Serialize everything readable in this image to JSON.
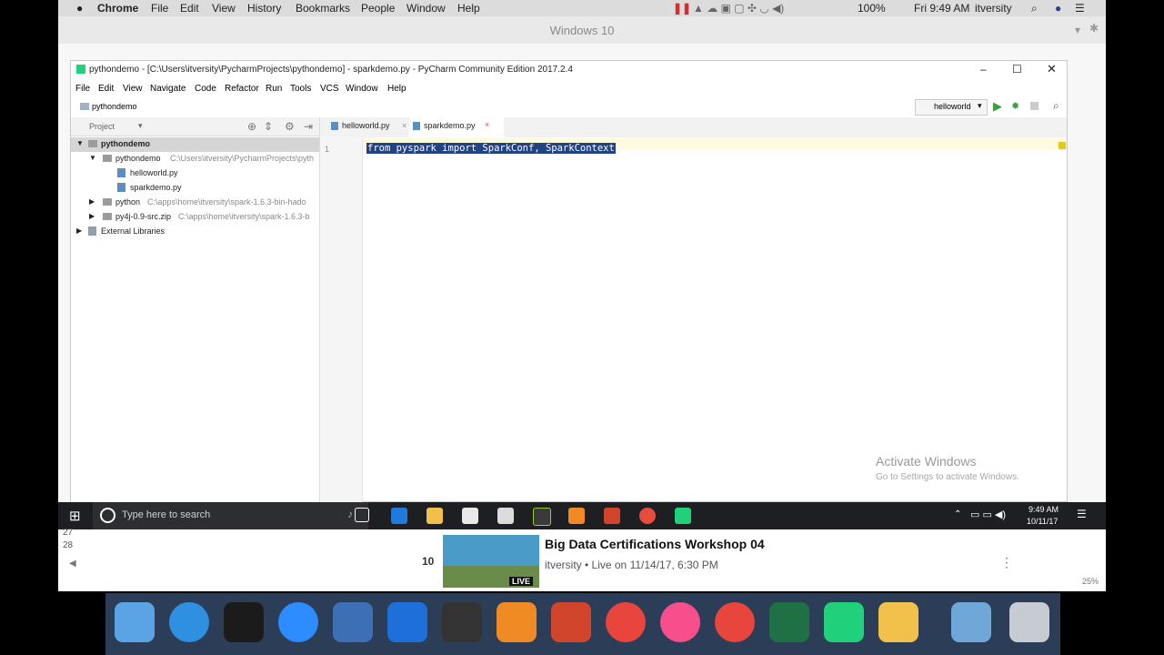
{
  "mac": {
    "app": "Chrome",
    "menu": [
      "File",
      "Edit",
      "View",
      "History",
      "Bookmarks",
      "People",
      "Window",
      "Help"
    ],
    "battery": "100%",
    "clock": "Fri 9:49 AM",
    "user": "itversity"
  },
  "remote": {
    "title": "Windows 10"
  },
  "pycharm": {
    "title": "pythondemo - [C:\\Users\\itversity\\PycharmProjects\\pythondemo] - sparkdemo.py - PyCharm Community Edition 2017.2.4",
    "menu": [
      "File",
      "Edit",
      "View",
      "Navigate",
      "Code",
      "Refactor",
      "Run",
      "Tools",
      "VCS",
      "Window",
      "Help"
    ],
    "breadcrumb": "pythondemo",
    "run_config": "helloworld",
    "project_label": "Project",
    "tree": [
      {
        "label": "pythondemo",
        "path": ""
      },
      {
        "label": "pythondemo",
        "path": "C:\\Users\\itversity\\PycharmProjects\\pyth"
      },
      {
        "label": "helloworld.py",
        "path": ""
      },
      {
        "label": "sparkdemo.py",
        "path": ""
      },
      {
        "label": "python",
        "path": "C:\\apps\\home\\itversity\\spark-1.6.3-bin-hado"
      },
      {
        "label": "py4j-0.9-src.zip",
        "path": "C:\\apps\\home\\itversity\\spark-1.6.3-b"
      },
      {
        "label": "External Libraries",
        "path": ""
      }
    ],
    "tabs": [
      "helloworld.py",
      "sparkdemo.py"
    ],
    "line_number": "1",
    "code": "from pyspark import SparkConf, SparkContext",
    "watermark_title": "Activate Windows",
    "watermark_sub": "Go to Settings to activate Windows."
  },
  "taskbar": {
    "search_placeholder": "Type here to search",
    "time": "9:49 AM",
    "date": "10/11/17"
  },
  "hangout": {
    "number": "10",
    "title": "Big Data Certifications Workshop 04",
    "meta": "itversity • Live on 11/14/17, 6:30 PM",
    "live": "LIVE",
    "row27": "27",
    "row28": "28",
    "zoom": "25%"
  }
}
